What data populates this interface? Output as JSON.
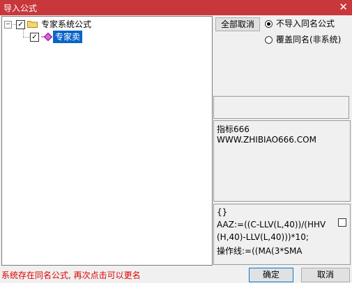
{
  "window": {
    "title": "导入公式",
    "close_glyph": "✕"
  },
  "tree": {
    "root": {
      "label": "专家系统公式",
      "expander": "−",
      "checked": true
    },
    "child": {
      "label": "专家卖",
      "checked": true
    }
  },
  "options": {
    "deselect_all_label": "全部取消",
    "radio_no_import": "不导入同名公式",
    "radio_overwrite": "覆盖同名(非系统)",
    "selected": "radio_no_import"
  },
  "info": {
    "line1": "指标666",
    "line2": "WWW.ZHIBIAO666.COM"
  },
  "formula": {
    "line1": "{}",
    "line2": "AAZ:=((C-LLV(L,40))/(HHV",
    "line3": "(H,40)-LLV(L,40)))*10;",
    "line4": "操作线:=((MA(3*SMA"
  },
  "status_text": "系统存在同名公式, 再次点击可以更名",
  "buttons": {
    "ok": "确定",
    "cancel": "取消"
  },
  "colors": {
    "titlebar": "#c8373c",
    "selection": "#0a64c8",
    "status": "#e00000"
  }
}
